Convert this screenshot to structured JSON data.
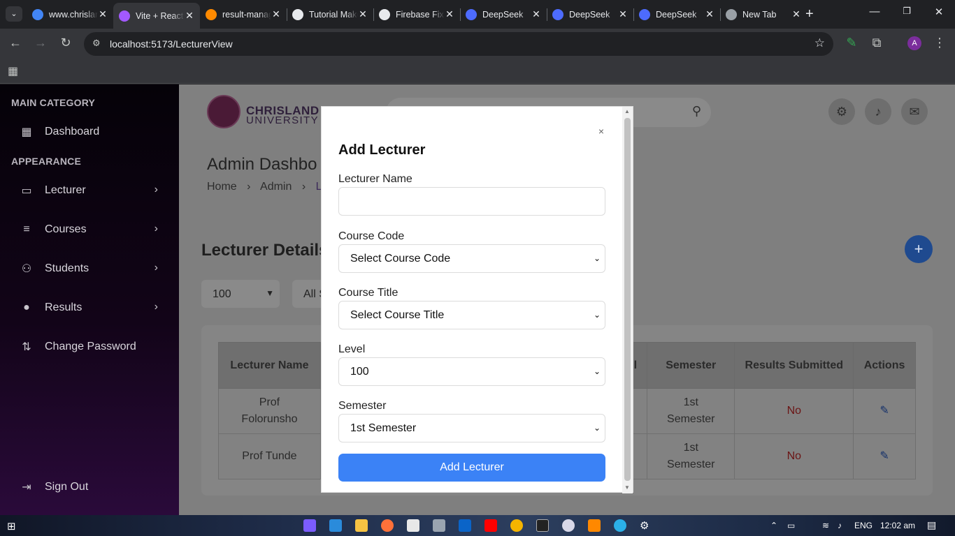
{
  "browser": {
    "tabs": [
      {
        "title": "www.chrisland",
        "icon": "google-icon",
        "color": "#4285f4"
      },
      {
        "title": "Vite + React",
        "icon": "vite-icon",
        "color": "#a259ff",
        "active": true
      },
      {
        "title": "result-management",
        "icon": "firebase-icon",
        "color": "#ff8a00"
      },
      {
        "title": "Tutorial Maker",
        "icon": "chatgpt-icon",
        "color": "#e8eaed"
      },
      {
        "title": "Firebase Fix",
        "icon": "ai-icon",
        "color": "#e8eaed"
      },
      {
        "title": "DeepSeek",
        "icon": "deepseek-icon",
        "color": "#4d6bfe"
      },
      {
        "title": "DeepSeek",
        "icon": "deepseek-icon",
        "color": "#4d6bfe"
      },
      {
        "title": "DeepSeek",
        "icon": "deepseek-icon",
        "color": "#4d6bfe"
      },
      {
        "title": "New Tab",
        "icon": "chrome-icon",
        "color": "#9aa0a6"
      }
    ],
    "url": "localhost:5173/LecturerView",
    "profile_initial": "A"
  },
  "sidebar": {
    "main_category": "MAIN CATEGORY",
    "dashboard": "Dashboard",
    "appearance": "APPEARANCE",
    "items": [
      {
        "label": "Lecturer",
        "icon": "lecturer-icon"
      },
      {
        "label": "Courses",
        "icon": "courses-icon"
      },
      {
        "label": "Students",
        "icon": "students-icon"
      },
      {
        "label": "Results",
        "icon": "results-icon"
      }
    ],
    "change_password": "Change Password",
    "sign_out": "Sign Out"
  },
  "header": {
    "logo_line1": "CHRISLAND",
    "logo_line2": "UNIVERSITY"
  },
  "page": {
    "title": "Admin Dashbo",
    "breadcrumb": [
      "Home",
      "Admin",
      "Le"
    ],
    "section_title": "Lecturer Details",
    "level_filter": "100",
    "semester_filter": "All S"
  },
  "table": {
    "headers": [
      "Lecturer Name",
      "l",
      "Semester",
      "Results Submitted",
      "Actions"
    ],
    "rows": [
      {
        "name": "Prof Folorunsho",
        "semester": "1st Semester",
        "submitted": "No"
      },
      {
        "name": "Prof Tunde",
        "semester": "1st Semester",
        "submitted": "No"
      }
    ]
  },
  "modal": {
    "title": "Add Lecturer",
    "close": "×",
    "name_label": "Lecturer Name",
    "name_value": "",
    "code_label": "Course Code",
    "code_value": "Select Course Code",
    "title_label": "Course Title",
    "title_value": "Select Course Title",
    "level_label": "Level",
    "level_value": "100",
    "semester_label": "Semester",
    "semester_value": "1st Semester",
    "submit": "Add Lecturer"
  },
  "taskbar": {
    "lang": "ENG",
    "time": "12:02 am"
  }
}
